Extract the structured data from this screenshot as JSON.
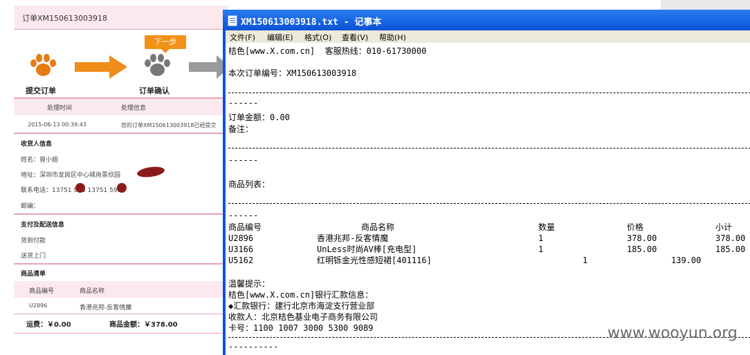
{
  "bg_page": {
    "order_header": "订单XM150613003918",
    "steps": {
      "submit": "提交订单",
      "next_badge": "下一步",
      "confirm": "订单确认"
    },
    "log_headers": {
      "time": "处理时间",
      "info": "处理信息"
    },
    "log_row": {
      "time": "2015-06-13 00:39:43",
      "info": "您的订单XM150613003918已经提交"
    },
    "receiver": {
      "section_title": "收货人信息",
      "name": "姓名：曾小姐",
      "address": "地址：深圳市龙岗区中心城尚景欣园",
      "phone": "联系电话：13751  983 13751  5983",
      "postcode": "邮编："
    },
    "payment": {
      "section_title": "支付及配送信息",
      "method": "货到付款",
      "delivery": "送货上门"
    },
    "goods": {
      "section_title": "商品清单",
      "col_no": "商品编号",
      "col_name": "商品名称",
      "row_no": "U2896",
      "row_name": "香港兆邦-反客情魔"
    },
    "totals": {
      "shipping": "运费：￥0.00",
      "amount": "商品金额：￥378.00"
    }
  },
  "notepad": {
    "title": "XM150613003918.txt - 记事本",
    "menu": [
      "文件(F)",
      "编辑(E)",
      "格式(O)",
      "查看(V)",
      "帮助(H)"
    ],
    "lines": {
      "hotline": "桔色[www.X.com.cn]  客服热线：010-61730000",
      "order_no": "本次订单编号：XM150613003918",
      "amount": "订单金额：0.00",
      "remark": "备注：",
      "goods_list": "商品列表：",
      "col_no": "商品编号",
      "col_name": "商品名称",
      "col_qty": "数量",
      "col_price": "价格",
      "col_subtotal": "小计",
      "tip": "温馨提示：",
      "bank_info": "桔色[www.X.com.cn]银行汇款信息：",
      "bank": "◆汇款银行：建行北京市海淀支行营业部",
      "payee": "收款人：北京桔色基业电子商务有限公司",
      "card": "卡号：1100 1007 3000 5300 9089"
    },
    "items": [
      {
        "no": "U2896",
        "name": "香港兆邦-反客情魔",
        "qty": "1",
        "price": "378.00",
        "subtotal": "378.00"
      },
      {
        "no": "U3166",
        "name": "UnLess时尚AV棒[充电型]",
        "qty": "1",
        "price": "185.00",
        "subtotal": "185.00"
      },
      {
        "no": "U5162",
        "name": "红明铄金光性感短裙[401116]",
        "qty": "1",
        "price": "139.00",
        "subtotal": ""
      }
    ],
    "separator_short": "------",
    "separator_bottom": "----------"
  },
  "watermark": "www.wooyun.org"
}
